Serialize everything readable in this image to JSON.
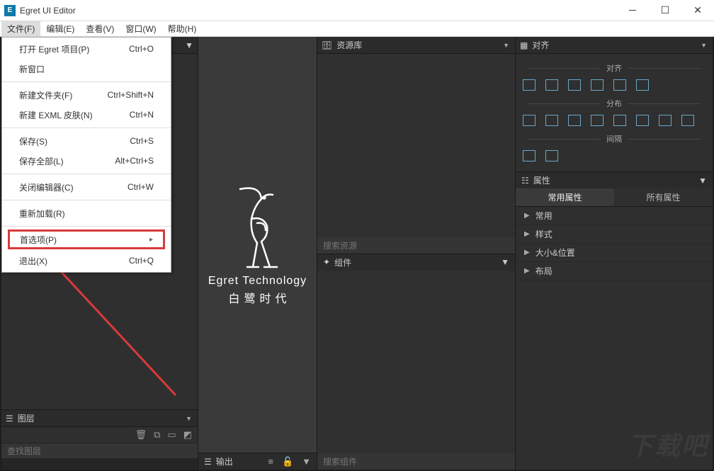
{
  "window": {
    "title": "Egret UI Editor",
    "app_icon_letter": "E"
  },
  "menubar": {
    "file": "文件(F)",
    "edit": "编辑(E)",
    "view": "查看(V)",
    "window": "窗口(W)",
    "help": "帮助(H)"
  },
  "dropdown": {
    "open_project": {
      "label": "打开 Egret 项目(P)",
      "shortcut": "Ctrl+O"
    },
    "new_window": {
      "label": "新窗口",
      "shortcut": ""
    },
    "new_folder": {
      "label": "新建文件夹(F)",
      "shortcut": "Ctrl+Shift+N"
    },
    "new_skin": {
      "label": "新建 EXML 皮肤(N)",
      "shortcut": "Ctrl+N"
    },
    "save": {
      "label": "保存(S)",
      "shortcut": "Ctrl+S"
    },
    "save_all": {
      "label": "保存全部(L)",
      "shortcut": "Alt+Ctrl+S"
    },
    "close_editor": {
      "label": "关闭编辑器(C)",
      "shortcut": "Ctrl+W"
    },
    "reload": {
      "label": "重新加载(R)",
      "shortcut": ""
    },
    "preferences": {
      "label": "首选项(P)",
      "shortcut": ""
    },
    "exit": {
      "label": "退出(X)",
      "shortcut": "Ctrl+Q"
    }
  },
  "left": {
    "layers_title": "图层",
    "search_placeholder": "查找图层"
  },
  "center": {
    "logo_line1": "Egret Technology",
    "logo_line2": "白鹭时代",
    "output_title": "输出"
  },
  "resource": {
    "title": "资源库",
    "search_placeholder": "搜索资源",
    "components_title": "组件",
    "components_search": "搜索组件"
  },
  "right": {
    "align_title": "对齐",
    "sec_align": "对齐",
    "sec_distribute": "分布",
    "sec_spacing": "间隔",
    "properties_title": "属性",
    "tab_common": "常用属性",
    "tab_all": "所有属性",
    "acc_common": "常用",
    "acc_style": "样式",
    "acc_size": "大小&位置",
    "acc_layout": "布局"
  },
  "watermark": "下载吧"
}
